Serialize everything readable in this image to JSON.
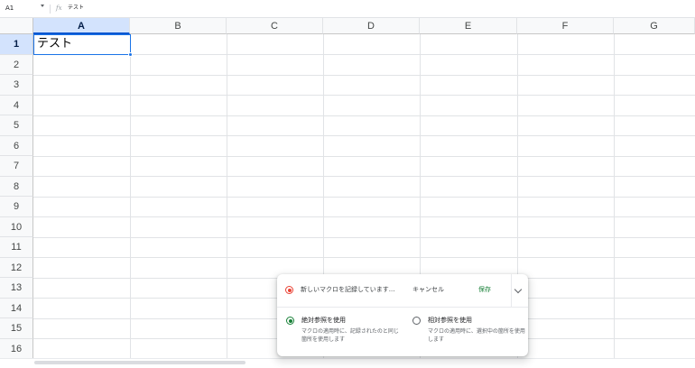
{
  "formula_bar": {
    "cell_ref": "A1",
    "fx_label": "fx",
    "content": "テスト"
  },
  "columns": [
    "A",
    "B",
    "C",
    "D",
    "E",
    "F",
    "G"
  ],
  "rows": [
    "1",
    "2",
    "3",
    "4",
    "5",
    "6",
    "7",
    "8",
    "9",
    "10",
    "11",
    "12",
    "13",
    "14",
    "15",
    "16"
  ],
  "selected_column": "A",
  "selected_row": "1",
  "cells": {
    "A1": "テスト"
  },
  "macro_panel": {
    "recording_text": "新しいマクロを記録しています...",
    "cancel_label": "キャンセル",
    "save_label": "保存",
    "options": [
      {
        "title": "絶対参照を使用",
        "description": "マクロの適用時に、記録されたのと同じ箇所を使用します",
        "selected": true
      },
      {
        "title": "相対参照を使用",
        "description": "マクロの適用時に、選択中の箇所を使用します",
        "selected": false
      }
    ]
  },
  "colors": {
    "selection": "#1a73e8",
    "header_selected": "#d3e3fd",
    "recording": "#ea4335",
    "save_accent": "#188038"
  }
}
